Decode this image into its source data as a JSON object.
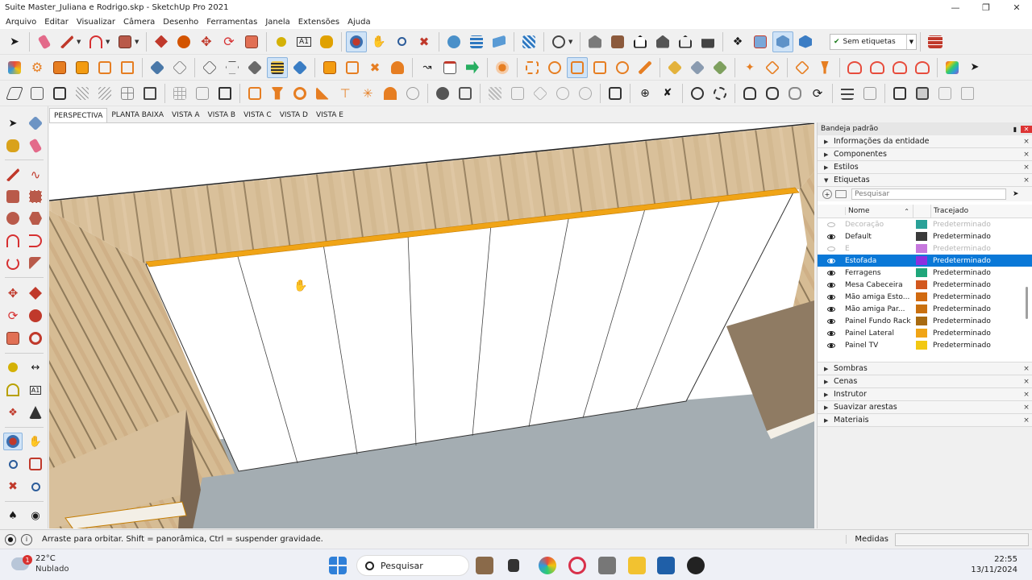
{
  "window": {
    "title": "Suite Master_Juliana e Rodrigo.skp - SketchUp Pro 2021"
  },
  "menu": [
    "Arquivo",
    "Editar",
    "Visualizar",
    "Câmera",
    "Desenho",
    "Ferramentas",
    "Janela",
    "Extensões",
    "Ajuda"
  ],
  "toolbar": {
    "tag_select_value": "Sem etiquetas"
  },
  "scenes": [
    "PERSPECTIVA",
    "PLANTA BAIXA",
    "VISTA A",
    "VISTA B",
    "VISTA C",
    "VISTA D",
    "VISTA E"
  ],
  "tray": {
    "title": "Bandeja padrão",
    "panels_top": [
      "Informações da entidade",
      "Componentes",
      "Estilos",
      "Etiquetas"
    ],
    "panels_bottom": [
      "Sombras",
      "Cenas",
      "Instrutor",
      "Suavizar arestas",
      "Materiais"
    ],
    "tags": {
      "search_placeholder": "Pesquisar",
      "col_name": "Nome",
      "col_dash": "Tracejado",
      "rows": [
        {
          "name": "Decoração",
          "color": "#2aa198",
          "dash": "Predeterminado",
          "visible": false,
          "dim": true
        },
        {
          "name": "Default",
          "color": "#3a3a3a",
          "dash": "Predeterminado",
          "visible": true,
          "dim": false
        },
        {
          "name": "E",
          "color": "#c678dd",
          "dash": "Predeterminado",
          "visible": false,
          "dim": true
        },
        {
          "name": "Estofada",
          "color": "#8b2fe0",
          "dash": "Predeterminado",
          "visible": true,
          "dim": false,
          "selected": true
        },
        {
          "name": "Ferragens",
          "color": "#1fa67a",
          "dash": "Predeterminado",
          "visible": true,
          "dim": false
        },
        {
          "name": "Mesa Cabeceira",
          "color": "#d2581e",
          "dash": "Predeterminado",
          "visible": true,
          "dim": false
        },
        {
          "name": "Mão amiga Esto...",
          "color": "#d16a10",
          "dash": "Predeterminado",
          "visible": true,
          "dim": false
        },
        {
          "name": "Mão amiga Par...",
          "color": "#c9700f",
          "dash": "Predeterminado",
          "visible": true,
          "dim": false
        },
        {
          "name": "Painel Fundo Rack",
          "color": "#a86a10",
          "dash": "Predeterminado",
          "visible": true,
          "dim": false
        },
        {
          "name": "Painel Lateral",
          "color": "#f0a416",
          "dash": "Predeterminado",
          "visible": true,
          "dim": false
        },
        {
          "name": "Painel TV",
          "color": "#f2c812",
          "dash": "Predeterminado",
          "visible": true,
          "dim": false
        }
      ]
    }
  },
  "status": {
    "message": "Arraste para orbitar. Shift = panorâmica, Ctrl = suspender gravidade.",
    "measure_label": "Medidas"
  },
  "taskbar": {
    "weather_temp": "22°C",
    "weather_desc": "Nublado",
    "weather_badge": "1",
    "search": "Pesquisar",
    "time": "22:55",
    "date": "13/11/2024"
  }
}
